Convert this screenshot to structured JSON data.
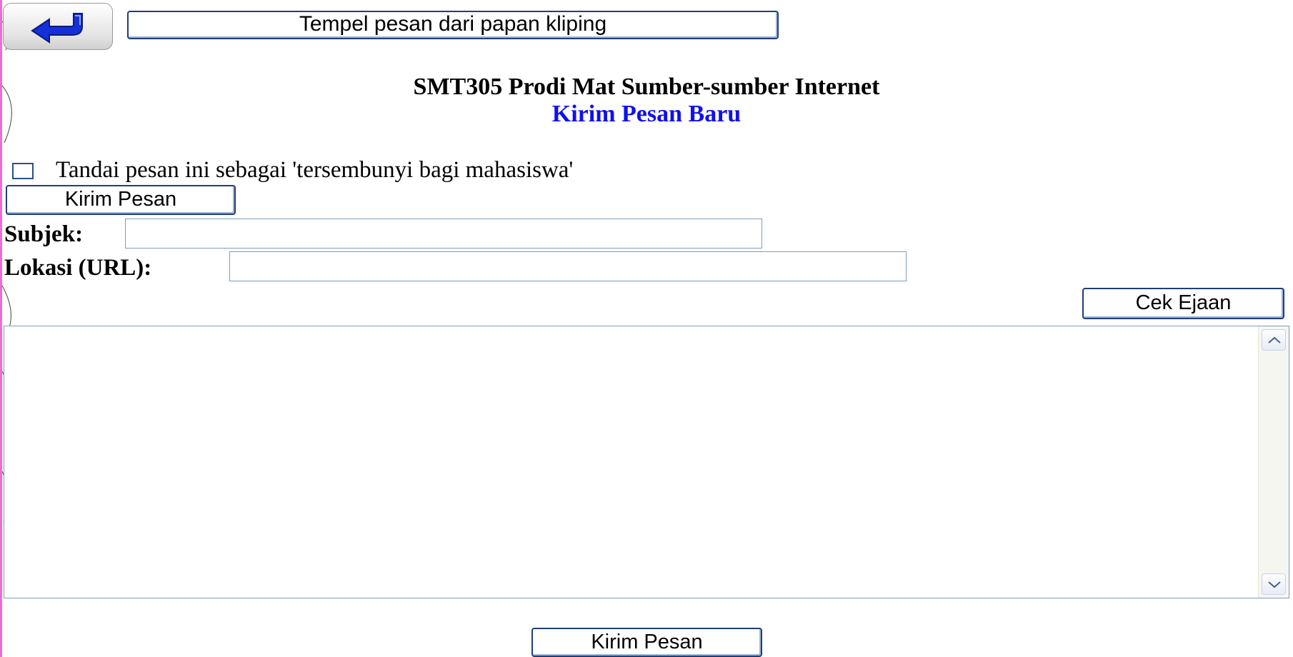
{
  "toolbar": {
    "back_icon": "return-arrow-icon",
    "paste_label": "Tempel pesan dari papan kliping"
  },
  "header": {
    "title": "SMT305 Prodi Mat Sumber-sumber Internet",
    "subtitle": "Kirim Pesan Baru",
    "subtitle_color": "#1010f0"
  },
  "form": {
    "hidden_checkbox_label": "Tandai pesan ini sebagai 'tersembunyi bagi mahasiswa'",
    "hidden_checked": false,
    "send_label": "Kirim Pesan",
    "subject_label": "Subjek",
    "subject_value": "",
    "url_label": "Lokasi (URL)",
    "url_value": "",
    "spellcheck_label": "Cek Ejaan",
    "message_value": "",
    "send_bottom_label": "Kirim Pesan"
  },
  "colors": {
    "accent": "#1f3f78",
    "left_edge": "#f06ad8"
  }
}
